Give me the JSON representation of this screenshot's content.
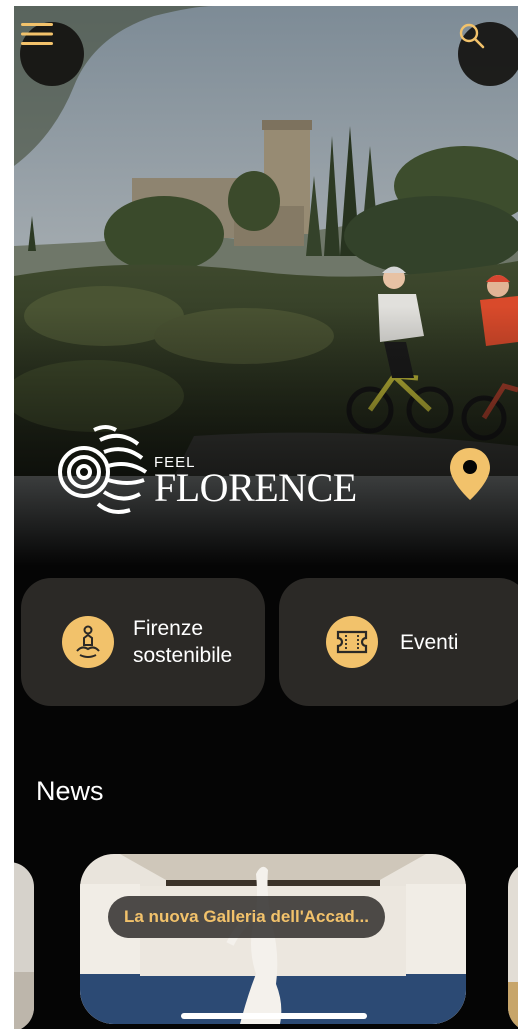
{
  "header": {
    "menu_icon": "hamburger-menu-icon",
    "search_icon": "search-icon"
  },
  "brand": {
    "feel": "FEEL",
    "name": "FLORENCE",
    "logo_icon": "feel-florence-logo"
  },
  "location_icon": "map-pin-icon",
  "categories": [
    {
      "label": "Firenze sostenibile",
      "icon": "meditation-person-icon"
    },
    {
      "label": "Eventi",
      "icon": "ticket-icon"
    }
  ],
  "news": {
    "title": "News",
    "items": [
      {
        "caption": "La nuova Galleria dell'Accad..."
      }
    ]
  },
  "colors": {
    "accent": "#f2c26b",
    "card": "#2b2926",
    "background": "#050505"
  }
}
